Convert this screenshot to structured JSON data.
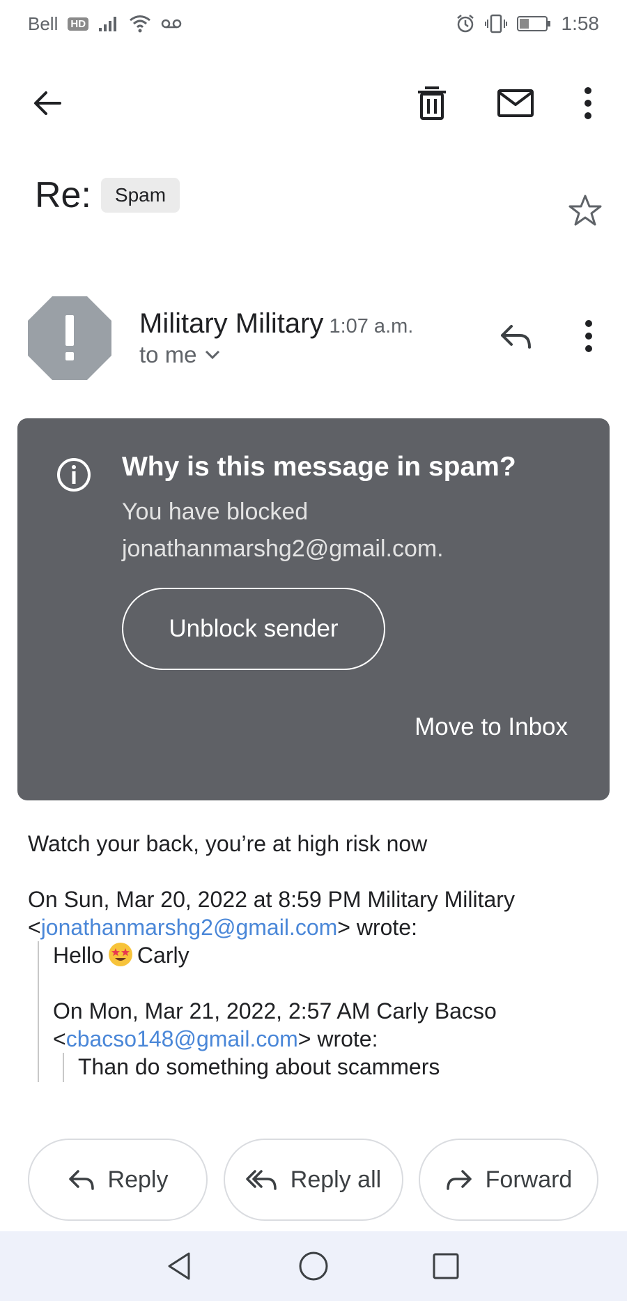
{
  "status_bar": {
    "carrier": "Bell",
    "hd_badge": "HD",
    "time": "1:58"
  },
  "toolbar": {
    "back_icon": "arrow-left-icon",
    "delete_icon": "trash-icon",
    "mark_unread_icon": "mail-icon",
    "more_icon": "more-vert-icon"
  },
  "email": {
    "subject": "Re:",
    "label": "Spam",
    "sender_name": "Military Military",
    "time": "1:07 a.m.",
    "recipient": "to me"
  },
  "spam_notice": {
    "title": "Why is this message in spam?",
    "line1": "You have blocked",
    "line2": "jonathanmarshg2@gmail.com.",
    "unblock_label": "Unblock sender",
    "move_label": "Move to Inbox"
  },
  "body": {
    "text": "Watch your back, you’re at high risk now",
    "quote_header_pre": "On Sun, Mar 20, 2022 at 8:59 PM Military Military",
    "quote_email_open": "<",
    "quote_email": "jonathanmarshg2@gmail.com",
    "quote_email_close": "> wrote:",
    "hello_pre": "Hello",
    "hello_post": "Carly",
    "quote2_header_pre": "On Mon, Mar 21, 2022, 2:57 AM Carly Bacso",
    "quote2_email_open": "<",
    "quote2_email": "cbacso148@gmail.com",
    "quote2_email_close": "> wrote:",
    "quote2_text": "Than do something about scammers"
  },
  "actions": {
    "reply": "Reply",
    "reply_all": "Reply all",
    "forward": "Forward"
  },
  "colors": {
    "spam_card": "#5f6166",
    "link": "#4a87d8",
    "nav_bar": "#eef1fa"
  }
}
